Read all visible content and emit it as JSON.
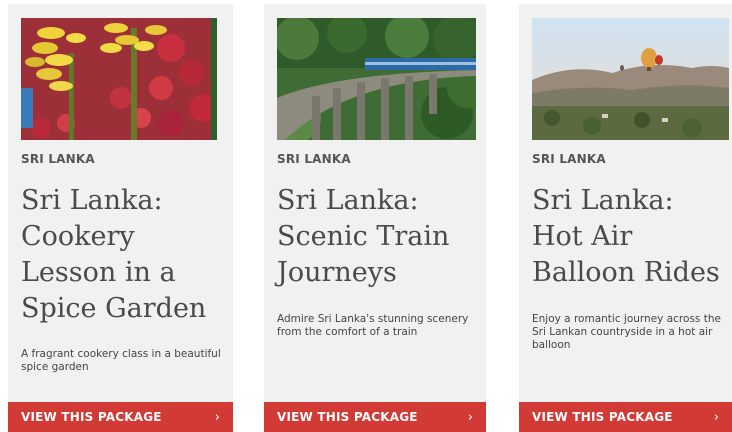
{
  "cards": [
    {
      "country": "SRI LANKA",
      "title": "Sri Lanka: Cookery Lesson in a Spice Garden",
      "description": "A fragrant cookery class in a beautiful spice garden",
      "cta_label": "VIEW THIS PACKAGE",
      "cta_icon": "chevron-right-icon"
    },
    {
      "country": "SRI LANKA",
      "title": "Sri Lanka: Scenic Train Journeys",
      "description": "Admire Sri Lanka's stunning scenery from the comfort of a train",
      "cta_label": "VIEW THIS PACKAGE",
      "cta_icon": "chevron-right-icon"
    },
    {
      "country": "SRI LANKA",
      "title": "Sri Lanka: Hot Air Balloon Rides",
      "description": "Enjoy a romantic journey across the Sri Lankan countryside in a hot air balloon",
      "cta_label": "VIEW THIS PACKAGE",
      "cta_icon": "chevron-right-icon"
    }
  ],
  "colors": {
    "card_background": "#f1f1f1",
    "cta_background": "#d23a36",
    "cta_text": "#ffffff",
    "title_text": "#4a4a4a"
  }
}
